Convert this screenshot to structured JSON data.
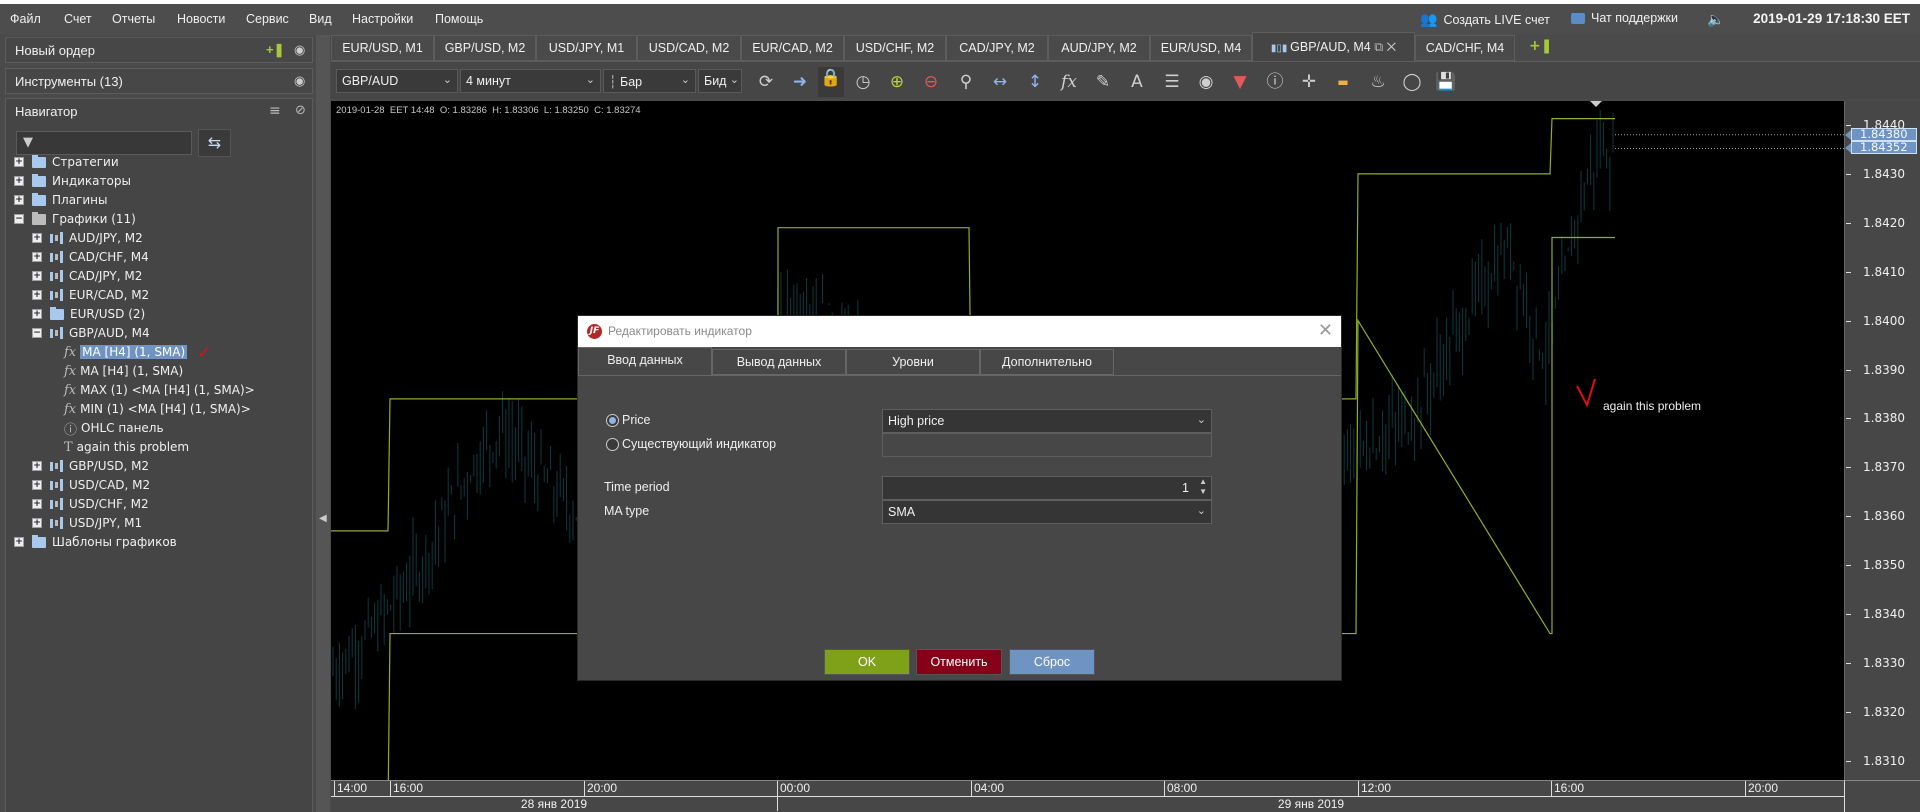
{
  "menu": [
    "Файл",
    "Счет",
    "Отчеты",
    "Новости",
    "Сервис",
    "Вид",
    "Настройки",
    "Помощь"
  ],
  "topbar": {
    "create_live": "Создать LIVE счет",
    "support_chat": "Чат поддержки",
    "datetime": "2019-01-29 17:18:30 EET"
  },
  "left_panel": {
    "new_order": "Новый ордер",
    "instruments": "Инструменты (13)",
    "navigator": "Навигатор",
    "filter_placeholder": "",
    "tree": [
      {
        "label": "Стратегии",
        "level": 0,
        "type": "folder",
        "toggle": "+"
      },
      {
        "label": "Индикаторы",
        "level": 0,
        "type": "folder",
        "toggle": "+"
      },
      {
        "label": "Плагины",
        "level": 0,
        "type": "folder",
        "toggle": "+"
      },
      {
        "label": "Графики (11)",
        "level": 0,
        "type": "folder-open",
        "toggle": "-"
      },
      {
        "label": "AUD/JPY, M2",
        "level": 1,
        "type": "chart",
        "toggle": "+"
      },
      {
        "label": "CAD/CHF, M4",
        "level": 1,
        "type": "chart",
        "toggle": "+"
      },
      {
        "label": "CAD/JPY, M2",
        "level": 1,
        "type": "chart",
        "toggle": "+"
      },
      {
        "label": "EUR/CAD, M2",
        "level": 1,
        "type": "chart",
        "toggle": "+"
      },
      {
        "label": "EUR/USD (2)",
        "level": 1,
        "type": "folder",
        "toggle": "+"
      },
      {
        "label": "GBP/AUD, M4",
        "level": 1,
        "type": "chart",
        "toggle": "-"
      },
      {
        "label": "MA [H4] (1, SMA)",
        "level": 2,
        "type": "fx",
        "selected": true
      },
      {
        "label": "MA [H4] (1, SMA)",
        "level": 2,
        "type": "fx"
      },
      {
        "label": "MAX (1) <MA [H4] (1, SMA)>",
        "level": 2,
        "type": "fx"
      },
      {
        "label": "MIN (1) <MA [H4] (1, SMA)>",
        "level": 2,
        "type": "fx"
      },
      {
        "label": "OHLC панель",
        "level": 2,
        "type": "info"
      },
      {
        "label": "again this problem",
        "level": 2,
        "type": "text"
      },
      {
        "label": "GBP/USD, M2",
        "level": 1,
        "type": "chart",
        "toggle": "+"
      },
      {
        "label": "USD/CAD, M2",
        "level": 1,
        "type": "chart",
        "toggle": "+"
      },
      {
        "label": "USD/CHF, M2",
        "level": 1,
        "type": "chart",
        "toggle": "+"
      },
      {
        "label": "USD/JPY, M1",
        "level": 1,
        "type": "chart",
        "toggle": "+"
      },
      {
        "label": "Шаблоны графиков",
        "level": 0,
        "type": "folder",
        "toggle": "+"
      }
    ]
  },
  "chart_tabs": [
    {
      "label": "EUR/USD, M1"
    },
    {
      "label": "GBP/USD, M2"
    },
    {
      "label": "USD/JPY, M1"
    },
    {
      "label": "USD/CAD, M2"
    },
    {
      "label": "EUR/CAD, M2"
    },
    {
      "label": "USD/CHF, M2"
    },
    {
      "label": "CAD/JPY, M2"
    },
    {
      "label": "AUD/JPY, M2"
    },
    {
      "label": "EUR/USD, M4"
    },
    {
      "label": "GBP/AUD, M4",
      "active": true
    },
    {
      "label": "CAD/CHF, M4"
    }
  ],
  "toolbar": {
    "instrument": "GBP/AUD",
    "period": "4 минут",
    "chart_type": "Бар",
    "side": "Бид"
  },
  "chart": {
    "ohlc_info": "2019-01-28  EET 14:48  O: 1.83286  H: 1.83306  L: 1.83250  C: 1.83274",
    "price_ticks": [
      "1.8440",
      "1.8430",
      "1.8420",
      "1.8410",
      "1.8400",
      "1.8390",
      "1.8380",
      "1.8370",
      "1.8360",
      "1.8350",
      "1.8340",
      "1.8330",
      "1.8320",
      "1.8310"
    ],
    "price_labels": [
      "1.84380",
      "1.84352"
    ],
    "time_ticks": [
      "14:00",
      "16:00",
      "20:00",
      "00:00",
      "04:00",
      "08:00",
      "12:00",
      "16:00",
      "20:00"
    ],
    "days": [
      "28 янв 2019",
      "29 янв 2019"
    ],
    "annotation": "again this problem",
    "colors": {
      "ma_line": "#8fae2e",
      "bars": "#0f3a40",
      "background": "#000000"
    }
  },
  "dialog": {
    "title": "Редактировать индикатор",
    "tabs": [
      "Ввод данных",
      "Вывод данных",
      "Уровни",
      "Дополнительно"
    ],
    "active_tab": "Ввод данных",
    "price_label": "Price",
    "price_selected": true,
    "price_source": "High price",
    "existing_indicator_label": "Существующий индикатор",
    "existing_indicator_value": "",
    "time_period_label": "Time period",
    "time_period": "1",
    "ma_type_label": "MA type",
    "ma_type": "SMA",
    "ok": "OK",
    "cancel": "Отменить",
    "reset": "Сброс",
    "colors": {
      "ok": "#7fa11a",
      "cancel": "#860018",
      "reset": "#6f93c2"
    }
  }
}
